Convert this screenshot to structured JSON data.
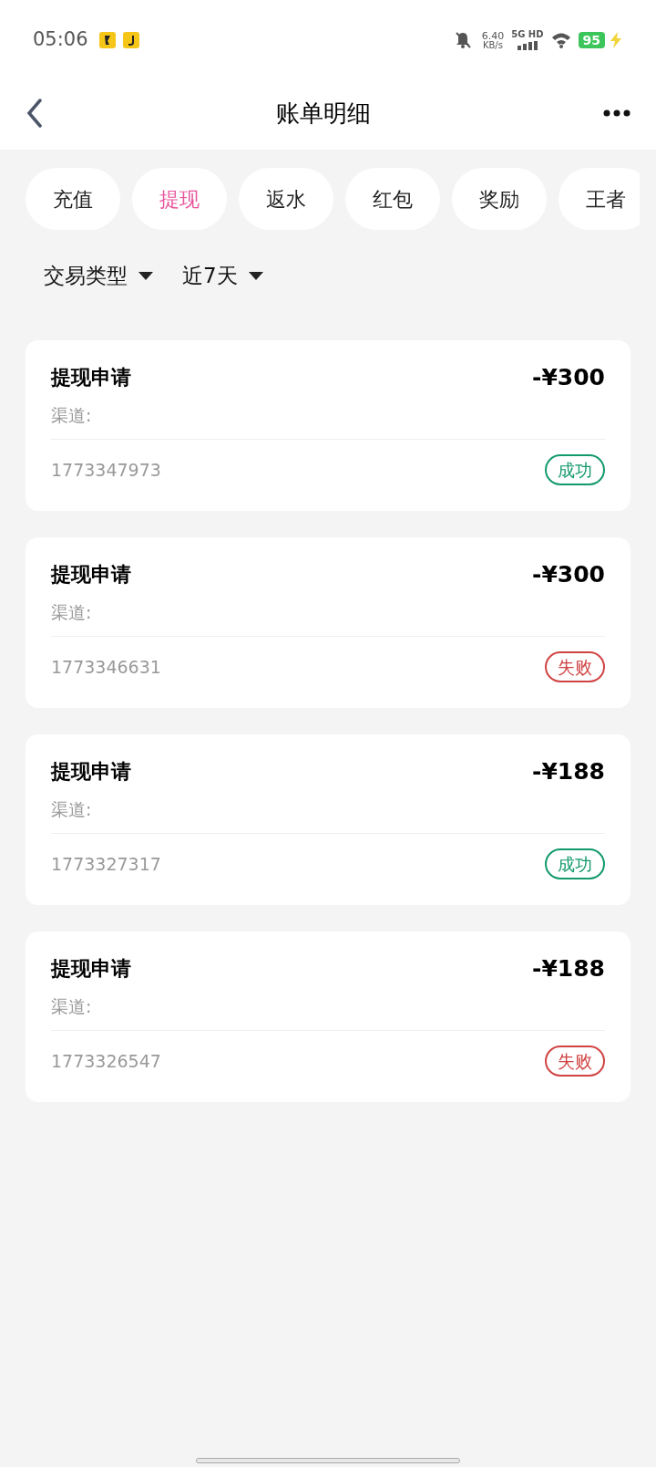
{
  "status_bar": {
    "time": "05:06",
    "net_speed": "6.40",
    "net_unit": "KB/s",
    "network": "5G HD",
    "battery": "95",
    "charging": true
  },
  "header": {
    "title": "账单明细"
  },
  "tabs": [
    {
      "label": "充值",
      "selected": false
    },
    {
      "label": "提现",
      "selected": true
    },
    {
      "label": "返水",
      "selected": false
    },
    {
      "label": "红包",
      "selected": false
    },
    {
      "label": "奖励",
      "selected": false
    },
    {
      "label": "王者",
      "selected": false
    }
  ],
  "filters": [
    {
      "label": "交易类型"
    },
    {
      "label": "近7天"
    }
  ],
  "records": [
    {
      "title": "提现申请",
      "amount": "-¥300",
      "channel": "渠道:",
      "order_no": "1773347973",
      "status": "成功",
      "kind": "success"
    },
    {
      "title": "提现申请",
      "amount": "-¥300",
      "channel": "渠道:",
      "order_no": "1773346631",
      "status": "失败",
      "kind": "fail"
    },
    {
      "title": "提现申请",
      "amount": "-¥188",
      "channel": "渠道:",
      "order_no": "1773327317",
      "status": "成功",
      "kind": "success"
    },
    {
      "title": "提现申请",
      "amount": "-¥188",
      "channel": "渠道:",
      "order_no": "1773326547",
      "status": "失败",
      "kind": "fail"
    }
  ]
}
